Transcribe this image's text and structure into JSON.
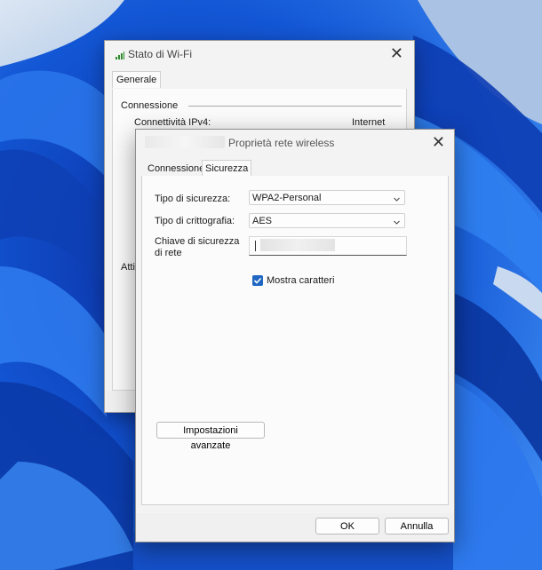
{
  "back_window": {
    "title": "Stato di Wi-Fi",
    "tab_label": "Generale",
    "group_label": "Connessione",
    "row_label": "Connettività IPv4:",
    "row_value": "Internet",
    "partial_label": "Atti"
  },
  "dialog": {
    "title": "Proprietà rete wireless",
    "tabs": [
      {
        "label": "Connessione",
        "selected": false
      },
      {
        "label": "Sicurezza",
        "selected": true
      }
    ],
    "security_type": {
      "label": "Tipo di sicurezza:",
      "value": "WPA2-Personal"
    },
    "encryption_type": {
      "label": "Tipo di crittografia:",
      "value": "AES"
    },
    "network_key": {
      "label": "Chiave di sicurezza di rete"
    },
    "show_characters": {
      "label": "Mostra caratteri",
      "checked": true
    },
    "advanced_button": "Impostazioni avanzate",
    "ok_button": "OK",
    "cancel_button": "Annulla"
  },
  "colors": {
    "accent": "#1f67c2",
    "wallpaper": "#1b5fd6"
  },
  "icons": [
    "wifi-signal-icon",
    "close-icon",
    "chevron-down-icon",
    "checkmark-icon"
  ]
}
